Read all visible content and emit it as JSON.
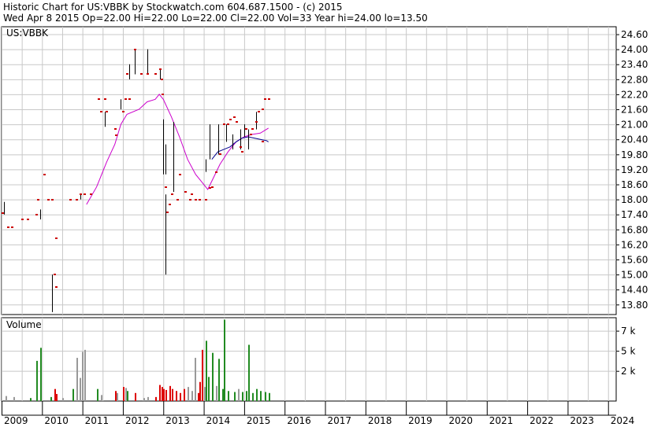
{
  "header": {
    "line1": "Historic Chart for US:VBBK by Stockwatch.com 604.687.1500 - (c) 2015",
    "line2": "Wed Apr  8 2015  Op=22.00  Hi=22.00  Lo=22.00  Cl=22.00  Vol=33  Year hi=24.00  lo=13.50"
  },
  "chart_data": [
    {
      "type": "ohlc",
      "title": "US:VBBK",
      "x_tick_labels": [
        "2009",
        "2010",
        "2011",
        "2012",
        "2013",
        "2014",
        "2015",
        "2016",
        "2017",
        "2018",
        "2019",
        "2020",
        "2021",
        "2022",
        "2023",
        "2024"
      ],
      "y_tick_labels": [
        "24.60",
        "24.00",
        "23.40",
        "22.80",
        "22.20",
        "21.60",
        "21.00",
        "20.40",
        "19.80",
        "19.20",
        "18.60",
        "18.00",
        "17.40",
        "16.80",
        "16.20",
        "15.60",
        "15.00",
        "14.40",
        "13.80"
      ],
      "ylim": [
        13.4,
        24.9
      ],
      "grid": true,
      "colors": {
        "price": "#cc0000",
        "bar": "#000000",
        "ma_short": "#00008b",
        "ma_long": "#cc00cc",
        "grid": "#c8c8c8"
      },
      "price_points": [
        [
          2009.02,
          17.45
        ],
        [
          2009.15,
          16.9
        ],
        [
          2009.25,
          16.9
        ],
        [
          2009.5,
          17.2
        ],
        [
          2009.65,
          17.2
        ],
        [
          2009.85,
          17.4
        ],
        [
          2009.9,
          18.0
        ],
        [
          2010.05,
          19.0
        ],
        [
          2010.15,
          18.0
        ],
        [
          2010.25,
          18.0
        ],
        [
          2010.3,
          15.0
        ],
        [
          2010.35,
          14.5
        ],
        [
          2010.35,
          16.45
        ],
        [
          2010.7,
          18.0
        ],
        [
          2010.85,
          18.0
        ],
        [
          2010.95,
          18.2
        ],
        [
          2011.05,
          18.2
        ],
        [
          2011.2,
          18.2
        ],
        [
          2011.4,
          22.0
        ],
        [
          2011.55,
          22.0
        ],
        [
          2011.45,
          21.5
        ],
        [
          2011.6,
          21.5
        ],
        [
          2011.8,
          20.8
        ],
        [
          2011.82,
          20.55
        ],
        [
          2012.0,
          21.5
        ],
        [
          2012.05,
          22.0
        ],
        [
          2012.15,
          22.0
        ],
        [
          2012.1,
          23.0
        ],
        [
          2012.3,
          24.0
        ],
        [
          2012.45,
          23.0
        ],
        [
          2012.6,
          23.0
        ],
        [
          2012.8,
          23.0
        ],
        [
          2012.92,
          23.2
        ],
        [
          2012.95,
          22.8
        ],
        [
          2012.98,
          22.2
        ],
        [
          2013.05,
          18.5
        ],
        [
          2013.15,
          17.8
        ],
        [
          2013.1,
          17.5
        ],
        [
          2013.2,
          18.2
        ],
        [
          2013.35,
          18.0
        ],
        [
          2013.4,
          19.0
        ],
        [
          2013.55,
          18.3
        ],
        [
          2013.65,
          18.0
        ],
        [
          2013.7,
          18.2
        ],
        [
          2013.8,
          18.0
        ],
        [
          2013.9,
          18.0
        ],
        [
          2014.05,
          18.0
        ],
        [
          2014.15,
          18.45
        ],
        [
          2014.2,
          18.5
        ],
        [
          2014.3,
          19.1
        ],
        [
          2014.4,
          19.8
        ],
        [
          2014.5,
          21.0
        ],
        [
          2014.6,
          21.0
        ],
        [
          2014.65,
          21.2
        ],
        [
          2014.75,
          21.3
        ],
        [
          2014.8,
          21.1
        ],
        [
          2014.9,
          20.1
        ],
        [
          2014.95,
          19.9
        ],
        [
          2015.05,
          20.8
        ],
        [
          2015.15,
          20.6
        ],
        [
          2015.2,
          20.8
        ],
        [
          2015.3,
          21.1
        ],
        [
          2015.35,
          21.5
        ],
        [
          2015.45,
          21.6
        ],
        [
          2015.5,
          22.0
        ],
        [
          2015.6,
          22.0
        ],
        [
          2015.45,
          20.3
        ]
      ],
      "bars": [
        [
          2009.05,
          17.4,
          17.9
        ],
        [
          2009.95,
          17.2,
          17.6
        ],
        [
          2010.25,
          13.5,
          15.0
        ],
        [
          2010.95,
          18.0,
          18.2
        ],
        [
          2011.55,
          20.9,
          21.5
        ],
        [
          2011.95,
          21.6,
          22.0
        ],
        [
          2012.15,
          22.8,
          23.4
        ],
        [
          2012.3,
          23.0,
          24.0
        ],
        [
          2012.6,
          23.0,
          24.0
        ],
        [
          2012.92,
          22.8,
          23.2
        ],
        [
          2013.0,
          19.0,
          21.2
        ],
        [
          2013.05,
          19.0,
          20.2
        ],
        [
          2013.05,
          15.0,
          18.2
        ],
        [
          2013.25,
          18.3,
          21.1
        ],
        [
          2014.05,
          19.1,
          19.6
        ],
        [
          2014.15,
          19.6,
          21.0
        ],
        [
          2014.35,
          19.8,
          21.0
        ],
        [
          2014.55,
          20.3,
          21.0
        ],
        [
          2014.7,
          20.0,
          20.6
        ],
        [
          2014.9,
          20.0,
          20.8
        ],
        [
          2015.0,
          20.5,
          21.0
        ],
        [
          2015.1,
          20.0,
          20.8
        ],
        [
          2015.3,
          20.8,
          21.5
        ]
      ],
      "ma_long": [
        [
          2011.1,
          17.8
        ],
        [
          2011.35,
          18.5
        ],
        [
          2011.6,
          19.5
        ],
        [
          2011.8,
          20.2
        ],
        [
          2011.95,
          21.0
        ],
        [
          2012.1,
          21.4
        ],
        [
          2012.4,
          21.6
        ],
        [
          2012.6,
          21.9
        ],
        [
          2012.8,
          22.0
        ],
        [
          2012.9,
          22.2
        ],
        [
          2013.0,
          22.0
        ],
        [
          2013.2,
          21.3
        ],
        [
          2013.4,
          20.5
        ],
        [
          2013.6,
          19.6
        ],
        [
          2013.8,
          19.0
        ],
        [
          2013.95,
          18.7
        ],
        [
          2014.1,
          18.4
        ],
        [
          2014.25,
          18.9
        ],
        [
          2014.4,
          19.4
        ],
        [
          2014.6,
          19.9
        ],
        [
          2014.8,
          20.3
        ],
        [
          2015.0,
          20.5
        ],
        [
          2015.2,
          20.6
        ],
        [
          2015.4,
          20.65
        ],
        [
          2015.6,
          20.85
        ]
      ],
      "ma_short": [
        [
          2014.2,
          19.6
        ],
        [
          2014.35,
          19.9
        ],
        [
          2014.5,
          20.0
        ],
        [
          2014.65,
          20.1
        ],
        [
          2014.8,
          20.3
        ],
        [
          2014.95,
          20.45
        ],
        [
          2015.1,
          20.5
        ],
        [
          2015.25,
          20.45
        ],
        [
          2015.4,
          20.4
        ],
        [
          2015.55,
          20.35
        ],
        [
          2015.6,
          20.3
        ]
      ]
    },
    {
      "type": "bar",
      "title": "Volume",
      "y_tick_labels": [
        "7 k",
        "5 k",
        "2 k"
      ],
      "y_tick_values": [
        7000,
        5000,
        3000
      ],
      "ylim": [
        0,
        8300
      ],
      "colors": {
        "up": "#228b22",
        "down": "#dd0000",
        "flat": "#999999"
      },
      "volume_bars": [
        [
          2009.1,
          500,
          "flat"
        ],
        [
          2009.3,
          400,
          "flat"
        ],
        [
          2009.7,
          300,
          "up"
        ],
        [
          2009.85,
          4000,
          "up"
        ],
        [
          2009.95,
          5300,
          "up"
        ],
        [
          2010.2,
          400,
          "up"
        ],
        [
          2010.3,
          1200,
          "down"
        ],
        [
          2010.35,
          700,
          "down"
        ],
        [
          2010.5,
          300,
          "flat"
        ],
        [
          2010.75,
          1200,
          "up"
        ],
        [
          2010.85,
          4300,
          "flat"
        ],
        [
          2010.92,
          2300,
          "flat"
        ],
        [
          2010.98,
          4900,
          "flat"
        ],
        [
          2011.05,
          5100,
          "flat"
        ],
        [
          2011.35,
          1200,
          "up"
        ],
        [
          2011.45,
          600,
          "flat"
        ],
        [
          2011.8,
          1000,
          "down"
        ],
        [
          2011.85,
          800,
          "flat"
        ],
        [
          2012.0,
          1400,
          "down"
        ],
        [
          2012.05,
          1300,
          "flat"
        ],
        [
          2012.1,
          1000,
          "up"
        ],
        [
          2012.3,
          800,
          "down"
        ],
        [
          2012.5,
          300,
          "flat"
        ],
        [
          2012.6,
          400,
          "flat"
        ],
        [
          2012.8,
          400,
          "down"
        ],
        [
          2012.9,
          1600,
          "down"
        ],
        [
          2012.95,
          1400,
          "down"
        ],
        [
          2013.0,
          1200,
          "down"
        ],
        [
          2013.05,
          1100,
          "down"
        ],
        [
          2013.15,
          1500,
          "down"
        ],
        [
          2013.2,
          1200,
          "down"
        ],
        [
          2013.3,
          1000,
          "down"
        ],
        [
          2013.4,
          800,
          "down"
        ],
        [
          2013.5,
          1200,
          "down"
        ],
        [
          2013.6,
          1400,
          "flat"
        ],
        [
          2013.7,
          1000,
          "flat"
        ],
        [
          2013.78,
          4300,
          "flat"
        ],
        [
          2013.85,
          800,
          "down"
        ],
        [
          2013.9,
          1900,
          "down"
        ],
        [
          2013.95,
          5100,
          "down"
        ],
        [
          2014.0,
          1400,
          "flat"
        ],
        [
          2014.05,
          6000,
          "up"
        ],
        [
          2014.1,
          2400,
          "up"
        ],
        [
          2014.2,
          4800,
          "up"
        ],
        [
          2014.3,
          1500,
          "flat"
        ],
        [
          2014.35,
          4200,
          "up"
        ],
        [
          2014.45,
          1200,
          "up"
        ],
        [
          2014.5,
          8100,
          "up"
        ],
        [
          2014.6,
          1000,
          "up"
        ],
        [
          2014.75,
          900,
          "up"
        ],
        [
          2014.85,
          1200,
          "flat"
        ],
        [
          2014.95,
          900,
          "up"
        ],
        [
          2015.05,
          1000,
          "up"
        ],
        [
          2015.1,
          5600,
          "up"
        ],
        [
          2015.2,
          800,
          "up"
        ],
        [
          2015.3,
          1200,
          "up"
        ],
        [
          2015.4,
          1000,
          "up"
        ],
        [
          2015.5,
          900,
          "up"
        ],
        [
          2015.6,
          800,
          "up"
        ]
      ]
    }
  ]
}
